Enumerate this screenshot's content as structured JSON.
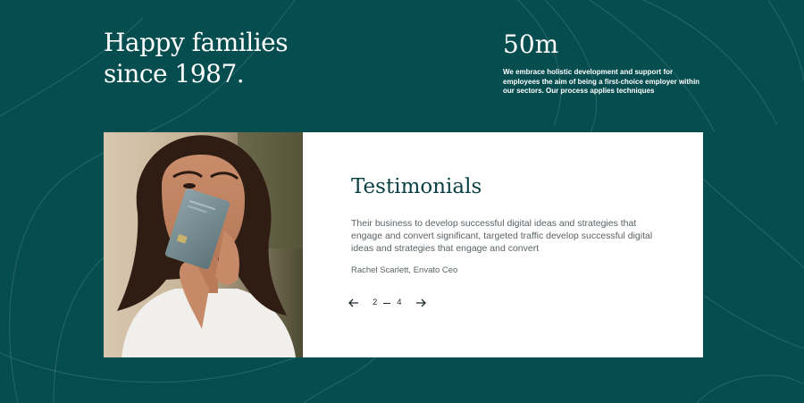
{
  "hero": {
    "headline_line1": "Happy families",
    "headline_line2": "since 1987."
  },
  "stat": {
    "number": "50m",
    "description": "We embrace holistic development and support for employees the aim of being a first-choice employer within our sectors. Our process applies techniques"
  },
  "testimonial": {
    "title": "Testimonials",
    "quote": "Their business to develop successful digital ideas and strategies that engage and convert significant, targeted traffic develop successful digital ideas and strategies that engage and convert",
    "author": "Rachel Scarlett, Envato Ceo",
    "photo_icon": "portrait-photo-icon"
  },
  "pager": {
    "current": "2",
    "total": "4",
    "prev_icon": "arrow-left-icon",
    "next_icon": "arrow-right-icon"
  },
  "colors": {
    "background": "#064d4f",
    "card": "#ffffff",
    "title": "#0b3f44",
    "body_text": "#5a6266"
  }
}
